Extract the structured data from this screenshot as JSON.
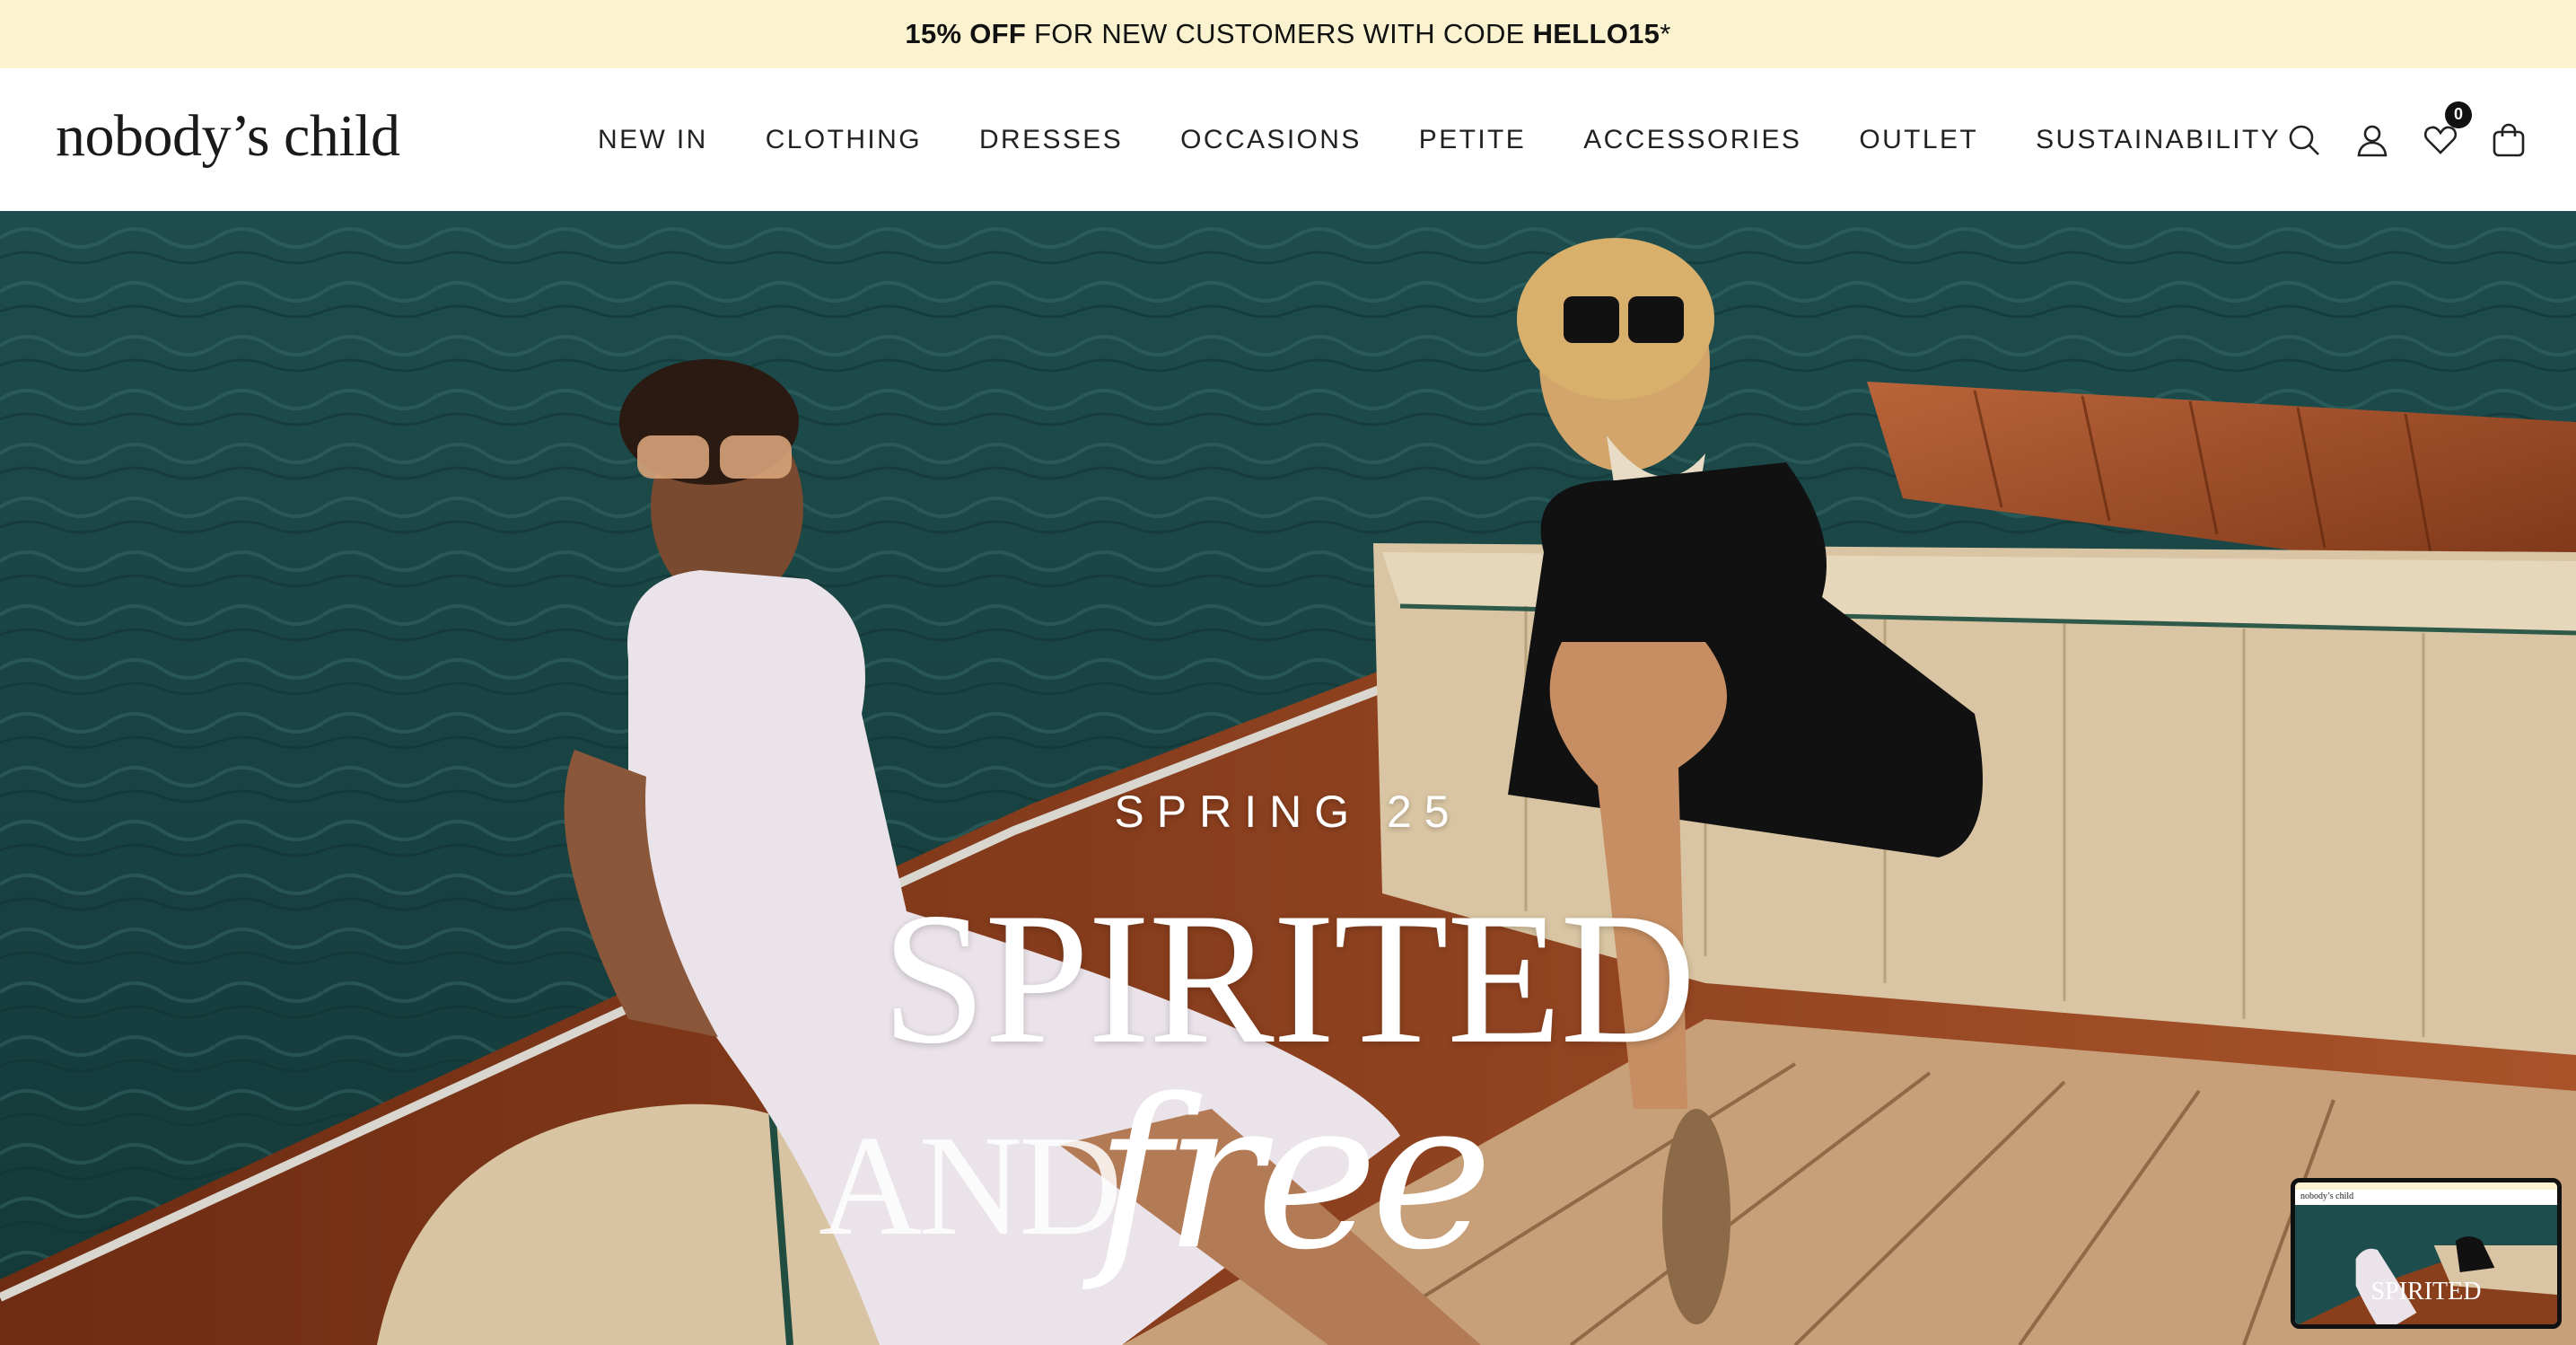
{
  "promo": {
    "prefix": "15% OFF",
    "middle": " FOR NEW CUSTOMERS WITH CODE ",
    "code": "HELLO15",
    "suffix": "*"
  },
  "header": {
    "logo": "nobody’s child",
    "nav": [
      {
        "label": "NEW IN"
      },
      {
        "label": "CLOTHING"
      },
      {
        "label": "DRESSES"
      },
      {
        "label": "OCCASIONS"
      },
      {
        "label": "PETITE"
      },
      {
        "label": "ACCESSORIES"
      },
      {
        "label": "OUTLET"
      },
      {
        "label": "SUSTAINABILITY"
      }
    ],
    "icons": {
      "search": "search-icon",
      "account": "user-icon",
      "wishlist": "heart-icon",
      "cart": "bag-icon"
    },
    "wishlist_count": "0"
  },
  "hero": {
    "eyebrow": "SPRING 25",
    "title": "SPIRITED",
    "and_word": "AND",
    "free_word": "free"
  },
  "preview": {
    "logo": "nobody’s child",
    "title": "SPIRITED"
  },
  "colors": {
    "promo_bg": "#fbf3cf",
    "header_bg": "#ffffff",
    "text": "#222222",
    "hero_text": "#ffffff",
    "water": "#1d4a4a",
    "boat_wood": "#8a3f1c",
    "seat_cream": "#d9c5a3"
  }
}
